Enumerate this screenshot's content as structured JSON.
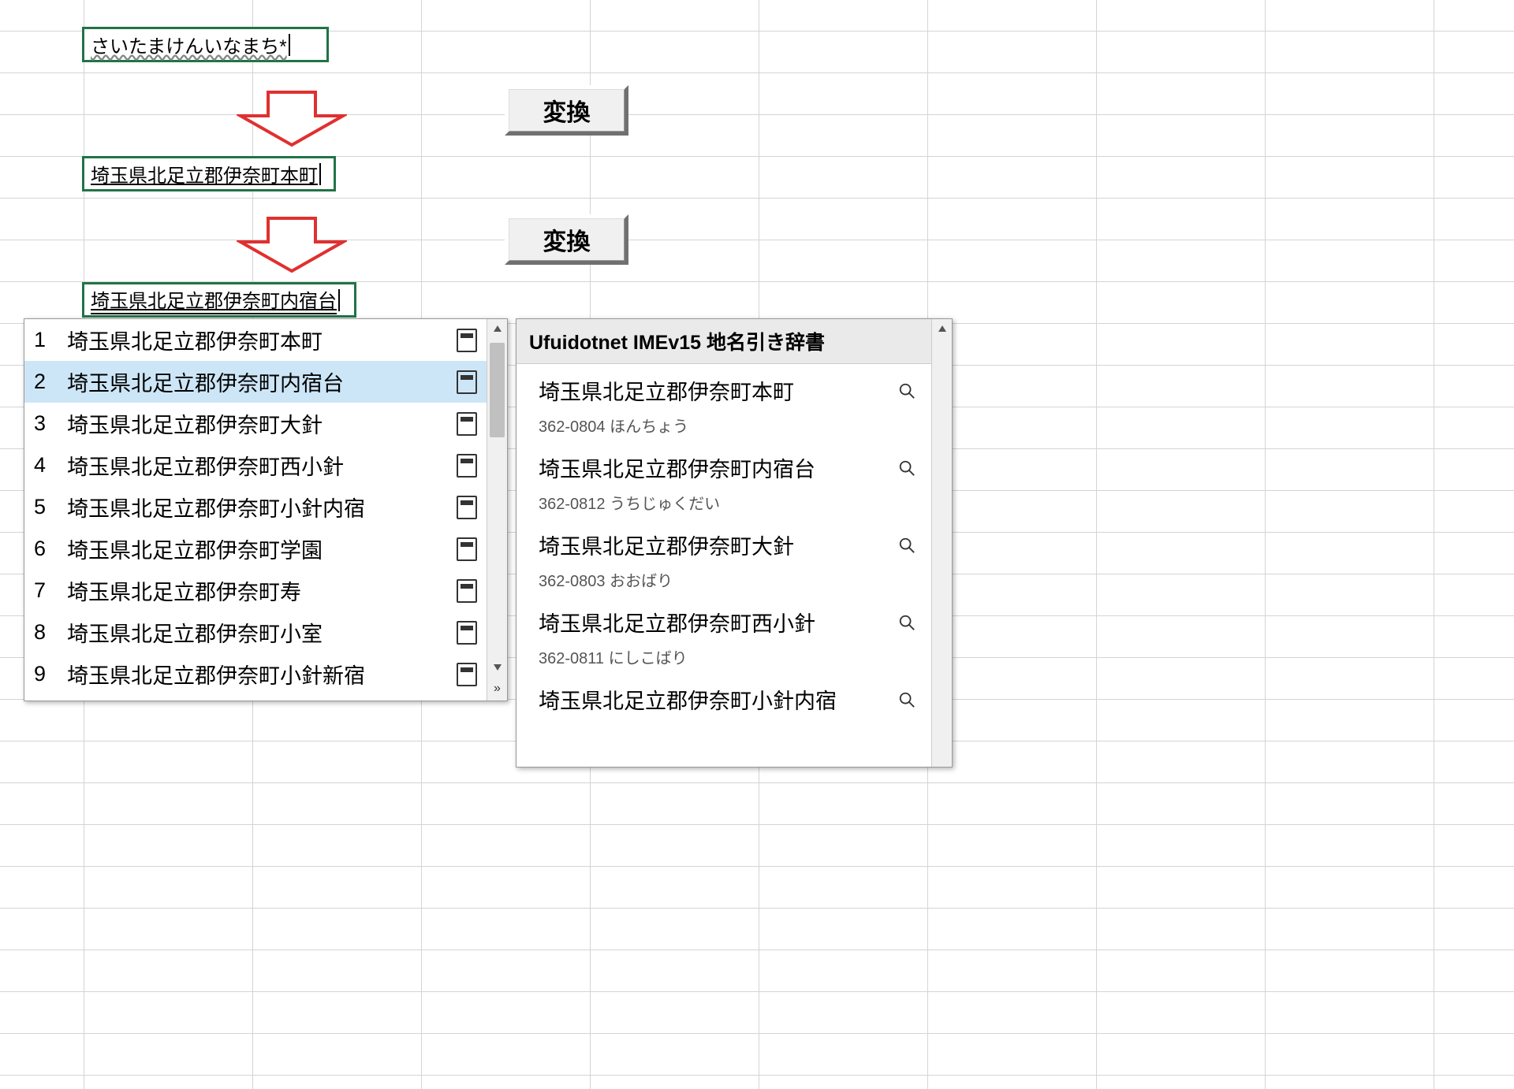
{
  "cells": {
    "input1": "さいたまけんいなまち*",
    "input2": "埼玉県北足立郡伊奈町本町",
    "input3": "埼玉県北足立郡伊奈町内宿台"
  },
  "buttons": {
    "convert": "変換"
  },
  "ime": {
    "candidates": [
      {
        "num": "1",
        "text": "埼玉県北足立郡伊奈町本町"
      },
      {
        "num": "2",
        "text": "埼玉県北足立郡伊奈町内宿台"
      },
      {
        "num": "3",
        "text": "埼玉県北足立郡伊奈町大針"
      },
      {
        "num": "4",
        "text": "埼玉県北足立郡伊奈町西小針"
      },
      {
        "num": "5",
        "text": "埼玉県北足立郡伊奈町小針内宿"
      },
      {
        "num": "6",
        "text": "埼玉県北足立郡伊奈町学園"
      },
      {
        "num": "7",
        "text": "埼玉県北足立郡伊奈町寿"
      },
      {
        "num": "8",
        "text": "埼玉県北足立郡伊奈町小室"
      },
      {
        "num": "9",
        "text": "埼玉県北足立郡伊奈町小針新宿"
      }
    ],
    "selected_index": 1
  },
  "dictionary": {
    "title": "Ufuidotnet IMEv15 地名引き辞書",
    "entries": [
      {
        "name": "埼玉県北足立郡伊奈町本町",
        "reading": "362-0804 ほんちょう"
      },
      {
        "name": "埼玉県北足立郡伊奈町内宿台",
        "reading": "362-0812 うちじゅくだい"
      },
      {
        "name": "埼玉県北足立郡伊奈町大針",
        "reading": "362-0803 おおばり"
      },
      {
        "name": "埼玉県北足立郡伊奈町西小針",
        "reading": "362-0811 にしこばり"
      },
      {
        "name": "埼玉県北足立郡伊奈町小針内宿",
        "reading": ""
      }
    ]
  }
}
